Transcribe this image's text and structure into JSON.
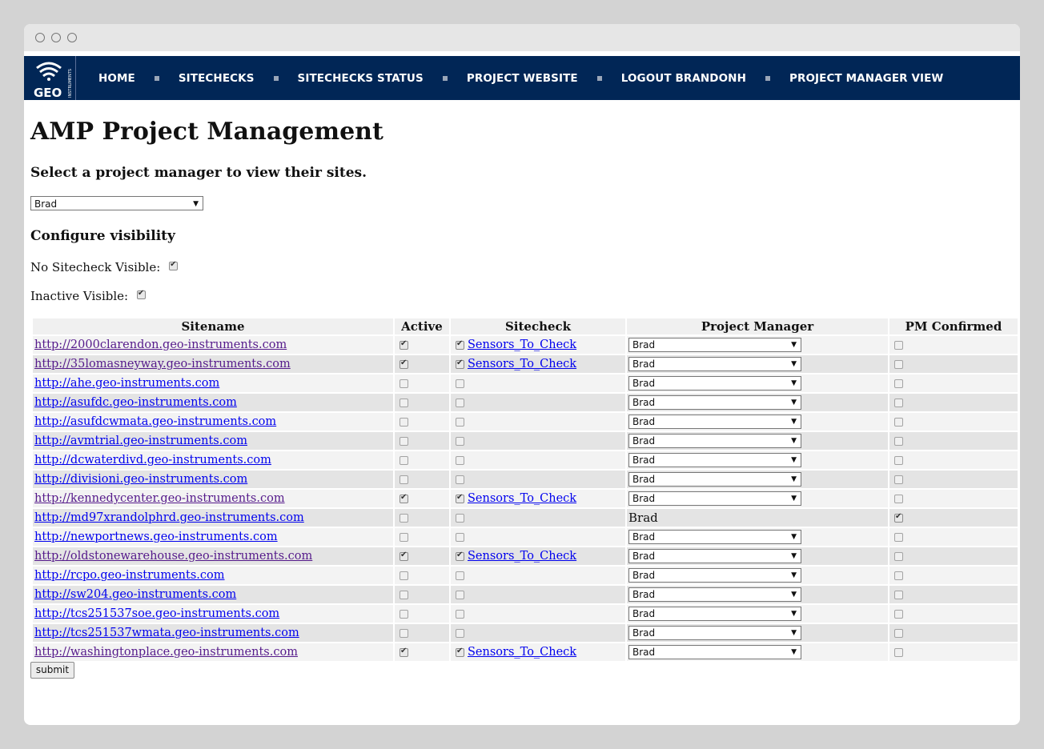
{
  "nav": {
    "logo_text": "GEO",
    "logo_sub": "INSTRUMENTS",
    "items": [
      "HOME",
      "SITECHECKS",
      "SITECHECKS STATUS",
      "PROJECT WEBSITE",
      "LOGOUT BRANDONH",
      "PROJECT MANAGER VIEW"
    ]
  },
  "page": {
    "title": "AMP Project Management",
    "select_prompt": "Select a project manager to view their sites.",
    "selected_manager": "Brad",
    "configure_heading": "Configure visibility",
    "no_sitecheck_label": "No Sitecheck Visible:",
    "no_sitecheck_checked": true,
    "inactive_label": "Inactive Visible:",
    "inactive_checked": true,
    "submit_label": "submit"
  },
  "table": {
    "headers": [
      "Sitename",
      "Active",
      "Sitecheck",
      "Project Manager",
      "PM Confirmed"
    ],
    "rows": [
      {
        "site": "http://2000clarendon.geo-instruments.com",
        "visited": true,
        "active": true,
        "sitecheck": true,
        "sitecheck_link": "Sensors_To_Check",
        "pm": "Brad",
        "pm_select": true,
        "confirmed": false
      },
      {
        "site": "http://35lomasneyway.geo-instruments.com",
        "visited": true,
        "active": true,
        "sitecheck": true,
        "sitecheck_link": "Sensors_To_Check",
        "pm": "Brad",
        "pm_select": true,
        "confirmed": false
      },
      {
        "site": "http://ahe.geo-instruments.com",
        "visited": false,
        "active": false,
        "sitecheck": false,
        "sitecheck_link": "",
        "pm": "Brad",
        "pm_select": true,
        "confirmed": false
      },
      {
        "site": "http://asufdc.geo-instruments.com",
        "visited": false,
        "active": false,
        "sitecheck": false,
        "sitecheck_link": "",
        "pm": "Brad",
        "pm_select": true,
        "confirmed": false
      },
      {
        "site": "http://asufdcwmata.geo-instruments.com",
        "visited": false,
        "active": false,
        "sitecheck": false,
        "sitecheck_link": "",
        "pm": "Brad",
        "pm_select": true,
        "confirmed": false
      },
      {
        "site": "http://avmtrial.geo-instruments.com",
        "visited": false,
        "active": false,
        "sitecheck": false,
        "sitecheck_link": "",
        "pm": "Brad",
        "pm_select": true,
        "confirmed": false
      },
      {
        "site": "http://dcwaterdivd.geo-instruments.com",
        "visited": false,
        "active": false,
        "sitecheck": false,
        "sitecheck_link": "",
        "pm": "Brad",
        "pm_select": true,
        "confirmed": false
      },
      {
        "site": "http://divisioni.geo-instruments.com",
        "visited": false,
        "active": false,
        "sitecheck": false,
        "sitecheck_link": "",
        "pm": "Brad",
        "pm_select": true,
        "confirmed": false
      },
      {
        "site": "http://kennedycenter.geo-instruments.com",
        "visited": true,
        "active": true,
        "sitecheck": true,
        "sitecheck_link": "Sensors_To_Check",
        "pm": "Brad",
        "pm_select": true,
        "confirmed": false
      },
      {
        "site": "http://md97xrandolphrd.geo-instruments.com",
        "visited": false,
        "active": false,
        "sitecheck": false,
        "sitecheck_link": "",
        "pm": "Brad",
        "pm_select": false,
        "confirmed": true
      },
      {
        "site": "http://newportnews.geo-instruments.com",
        "visited": false,
        "active": false,
        "sitecheck": false,
        "sitecheck_link": "",
        "pm": "Brad",
        "pm_select": true,
        "confirmed": false
      },
      {
        "site": "http://oldstonewarehouse.geo-instruments.com",
        "visited": true,
        "active": true,
        "sitecheck": true,
        "sitecheck_link": "Sensors_To_Check",
        "pm": "Brad",
        "pm_select": true,
        "confirmed": false
      },
      {
        "site": "http://rcpo.geo-instruments.com",
        "visited": false,
        "active": false,
        "sitecheck": false,
        "sitecheck_link": "",
        "pm": "Brad",
        "pm_select": true,
        "confirmed": false
      },
      {
        "site": "http://sw204.geo-instruments.com",
        "visited": false,
        "active": false,
        "sitecheck": false,
        "sitecheck_link": "",
        "pm": "Brad",
        "pm_select": true,
        "confirmed": false
      },
      {
        "site": "http://tcs251537soe.geo-instruments.com",
        "visited": false,
        "active": false,
        "sitecheck": false,
        "sitecheck_link": "",
        "pm": "Brad",
        "pm_select": true,
        "confirmed": false
      },
      {
        "site": "http://tcs251537wmata.geo-instruments.com",
        "visited": false,
        "active": false,
        "sitecheck": false,
        "sitecheck_link": "",
        "pm": "Brad",
        "pm_select": true,
        "confirmed": false
      },
      {
        "site": "http://washingtonplace.geo-instruments.com",
        "visited": true,
        "active": true,
        "sitecheck": true,
        "sitecheck_link": "Sensors_To_Check",
        "pm": "Brad",
        "pm_select": true,
        "confirmed": false
      }
    ]
  },
  "colors": {
    "navbar": "#012656",
    "link": "#0000ee",
    "visited_link": "#551a8b"
  }
}
